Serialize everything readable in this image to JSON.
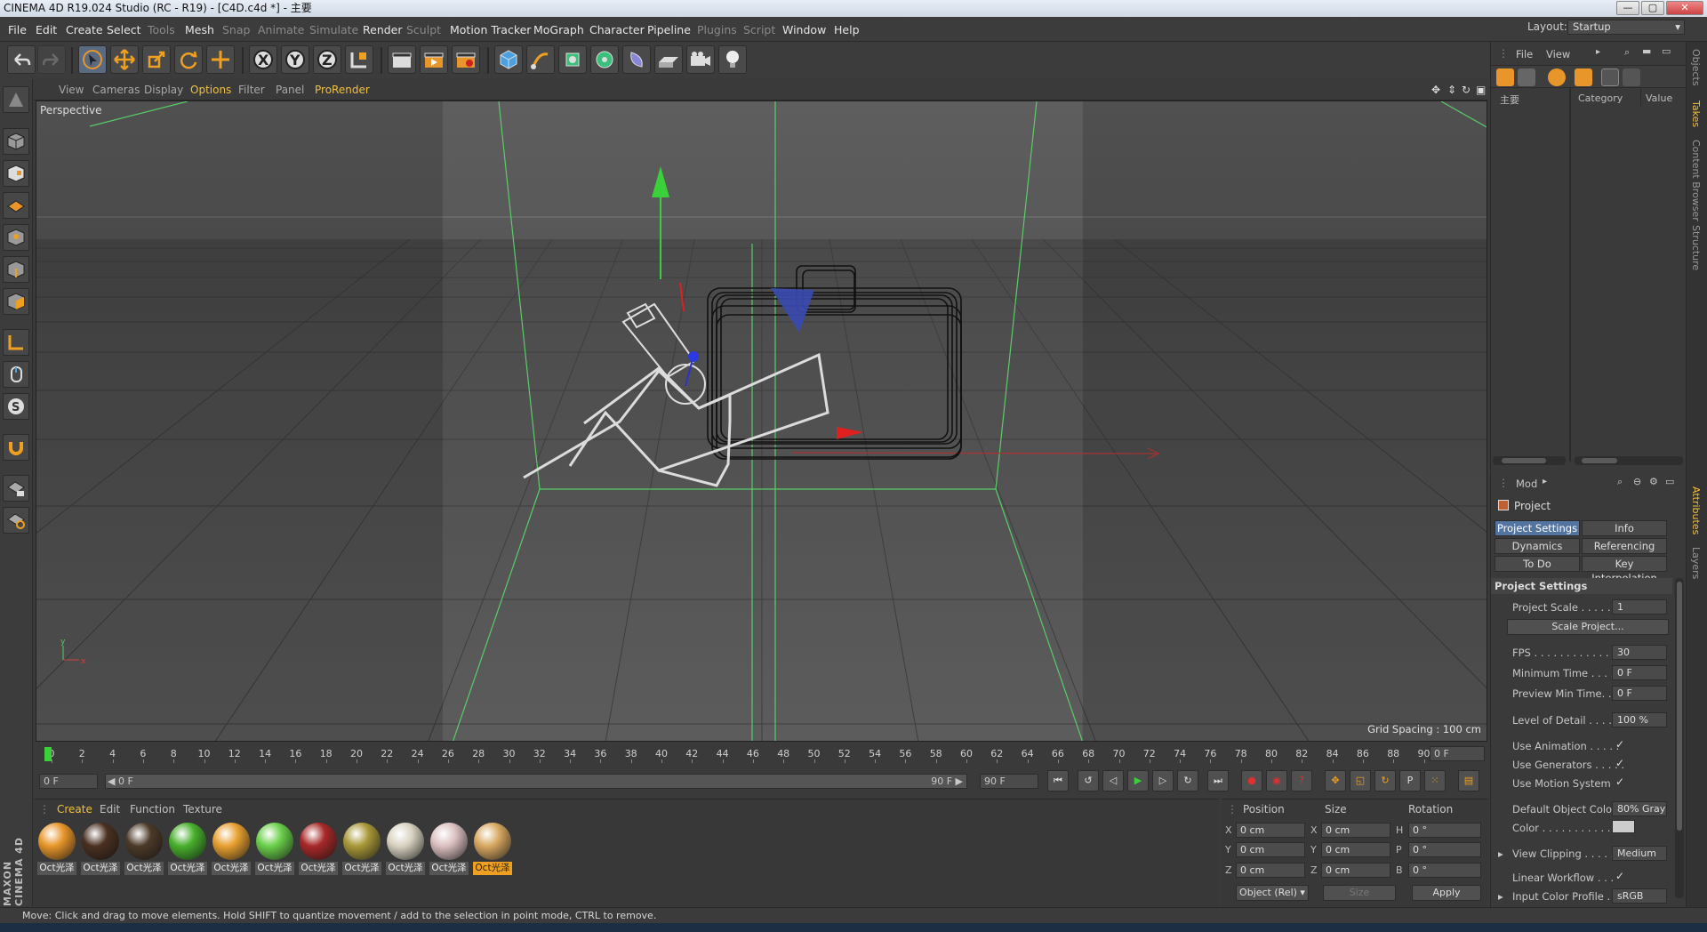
{
  "window": {
    "title": "CINEMA 4D R19.024 Studio (RC - R19) - [C4D.c4d *] - 主要"
  },
  "menu": {
    "items": [
      "File",
      "Edit",
      "Create",
      "Select",
      "Tools",
      "Mesh",
      "Snap",
      "Animate",
      "Simulate",
      "Render",
      "Sculpt",
      "Motion Tracker",
      "MoGraph",
      "Character",
      "Pipeline",
      "Plugins",
      "Script",
      "Window",
      "Help"
    ],
    "layout_label": "Layout:",
    "layout_value": "Startup"
  },
  "viewport": {
    "menu": [
      "View",
      "Cameras",
      "Display",
      "Options",
      "Filter",
      "Panel",
      "ProRender"
    ],
    "label": "Perspective",
    "grid_spacing": "Grid Spacing : 100 cm"
  },
  "timeline": {
    "ticks": [
      "0",
      "2",
      "4",
      "6",
      "8",
      "10",
      "12",
      "14",
      "16",
      "18",
      "20",
      "22",
      "24",
      "26",
      "28",
      "30",
      "32",
      "34",
      "36",
      "38",
      "40",
      "42",
      "44",
      "46",
      "48",
      "50",
      "52",
      "54",
      "56",
      "58",
      "60",
      "62",
      "64",
      "66",
      "68",
      "70",
      "72",
      "74",
      "76",
      "78",
      "80",
      "82",
      "84",
      "86",
      "88",
      "90"
    ],
    "current_frame": "0 F",
    "start": "0 F",
    "range_start": "◀ 0 F",
    "range_end": "90 F ▶",
    "end": "90 F"
  },
  "materials": {
    "tabs": [
      "Create",
      "Edit",
      "Function",
      "Texture"
    ],
    "items": [
      {
        "label": "Oct光泽",
        "color": "#e8962a"
      },
      {
        "label": "Oct光泽",
        "color": "#4a3020"
      },
      {
        "label": "Oct光泽",
        "color": "#4c3a28"
      },
      {
        "label": "Oct光泽",
        "color": "#48b02c"
      },
      {
        "label": "Oct光泽",
        "color": "#e8a030"
      },
      {
        "label": "Oct光泽",
        "color": "#6ad04a"
      },
      {
        "label": "Oct光泽",
        "color": "#a82828"
      },
      {
        "label": "Oct光泽",
        "color": "#a89838"
      },
      {
        "label": "Oct光泽",
        "color": "#d8d2c0"
      },
      {
        "label": "Oct光泽",
        "color": "#dcc0c0"
      },
      {
        "label": "Oct光泽",
        "color": "#d8a860"
      }
    ],
    "brand": "MAXON CINEMA 4D"
  },
  "coords": {
    "headers": [
      "Position",
      "Size",
      "Rotation"
    ],
    "rows": [
      {
        "p_axis": "X",
        "p": "0 cm",
        "s_axis": "X",
        "s": "0 cm",
        "r_axis": "H",
        "r": "0 °"
      },
      {
        "p_axis": "Y",
        "p": "0 cm",
        "s_axis": "Y",
        "s": "0 cm",
        "r_axis": "P",
        "r": "0 °"
      },
      {
        "p_axis": "Z",
        "p": "0 cm",
        "s_axis": "Z",
        "s": "0 cm",
        "r_axis": "B",
        "r": "0 °"
      }
    ],
    "mode": "Object (Rel) ▾",
    "size_mode": "Size",
    "apply": "Apply"
  },
  "status": "Move: Click and drag to move elements. Hold SHIFT to quantize movement / add to the selection in point mode, CTRL to remove.",
  "objects": {
    "menu": [
      "File",
      "View"
    ],
    "col_name": "主要",
    "col_category": "Category",
    "col_value": "Value"
  },
  "attributes": {
    "mode": "Mod",
    "title": "Project",
    "tabs": [
      [
        "Project Settings",
        "Info"
      ],
      [
        "Dynamics",
        "Referencing"
      ],
      [
        "To Do",
        "Key Interpolation"
      ]
    ],
    "section": "Project Settings",
    "project_scale": {
      "label": "Project Scale . . . . . .",
      "value": "1"
    },
    "scale_button": "Scale Project...",
    "fps": {
      "label": "FPS . . . . . . . . . . . . . .",
      "value": "30"
    },
    "min_time": {
      "label": "Minimum Time . . . . .",
      "value": "0 F"
    },
    "preview_min": {
      "label": "Preview Min Time. . .",
      "value": "0 F"
    },
    "lod": {
      "label": "Level of Detail . . . . .",
      "value": "100 %"
    },
    "use_anim": "Use Animation . . . . .",
    "use_gen": "Use Generators . . . . .",
    "use_motion": "Use Motion System",
    "def_color": {
      "label": "Default Object Color",
      "value": "80% Gray"
    },
    "color_label": "Color . . . . . . . . . . .",
    "clipping": {
      "label": "View Clipping . . . . .",
      "value": "Medium"
    },
    "linear": "Linear Workflow . . .",
    "profile": {
      "label": "Input Color Profile . .",
      "value": "sRGB"
    },
    "check": "✓"
  },
  "side_tabs": [
    "Objects",
    "Takes",
    "Content Browser",
    "Structure",
    "Attributes",
    "Layers"
  ]
}
